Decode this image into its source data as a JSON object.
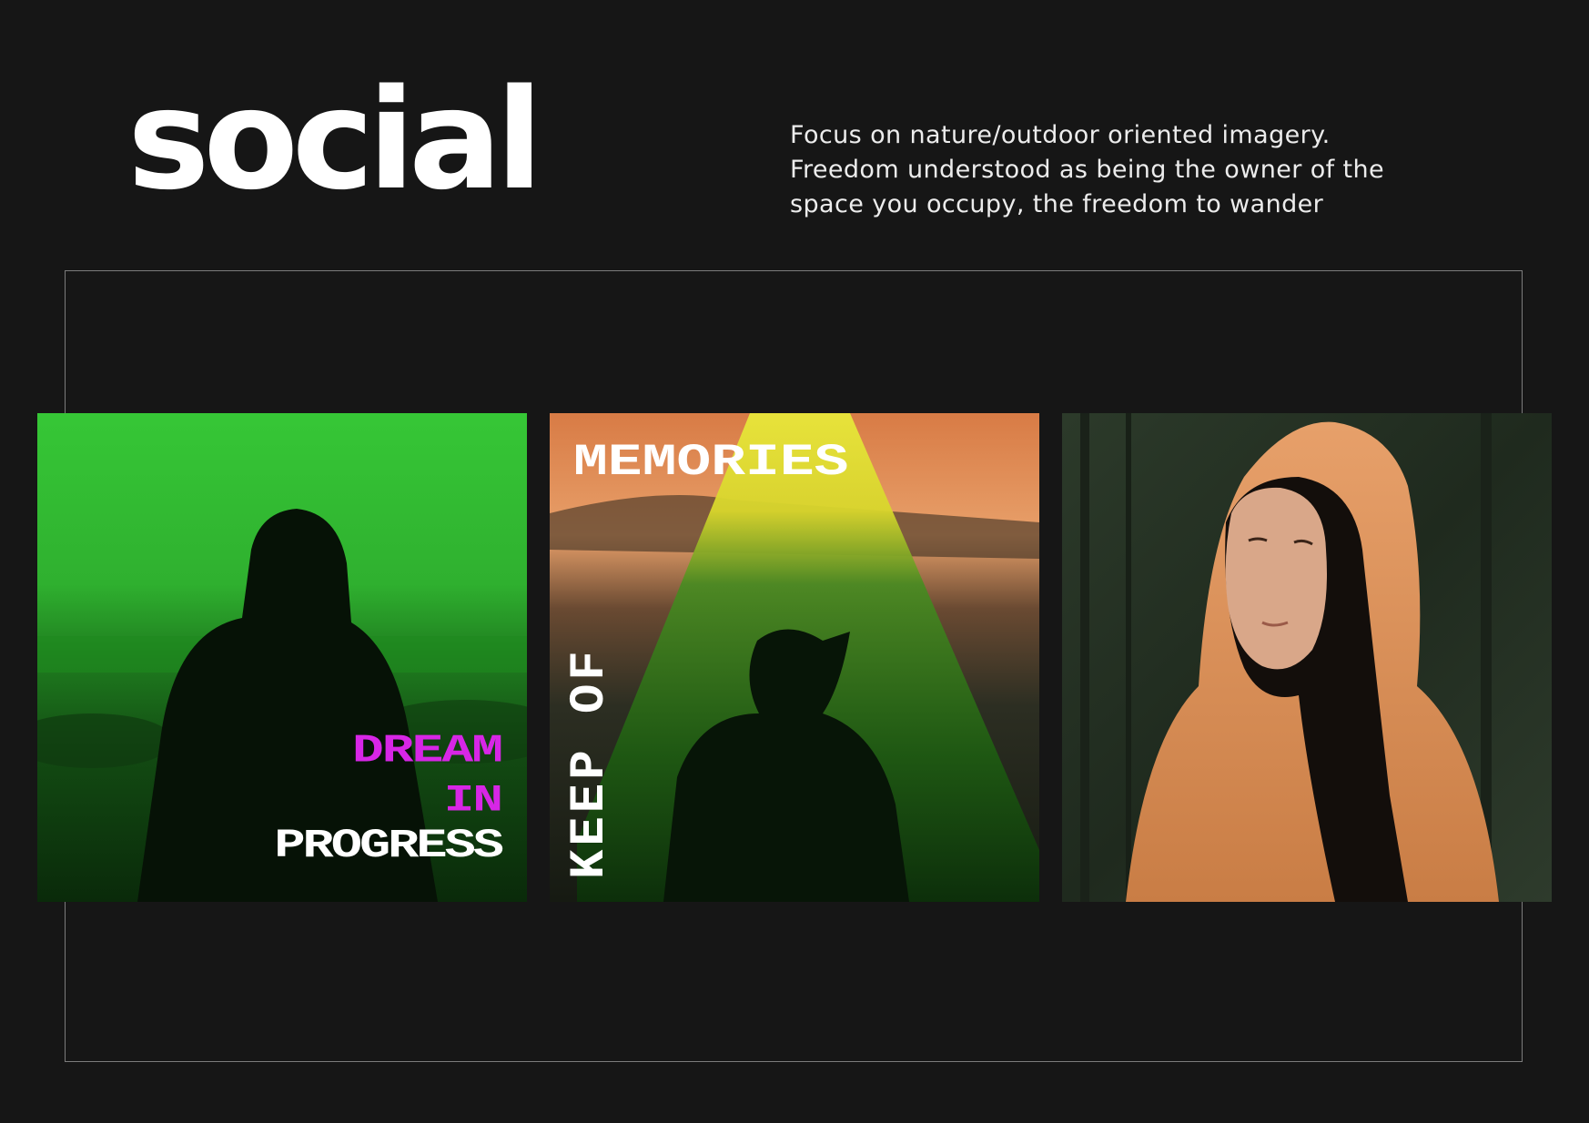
{
  "page": {
    "title": "social",
    "description_lines": [
      "Focus on nature/outdoor oriented imagery.",
      "Freedom understood as being the owner of the",
      "space you occupy, the freedom to wander"
    ]
  },
  "posts": [
    {
      "lines": [
        "DREAM",
        "IN",
        "PROGRESS"
      ],
      "accent": "#d726e6",
      "tint": "#2fb52f"
    },
    {
      "title": "MEMORIES",
      "vertical": "KEEP OF",
      "accent": "#e6e635",
      "tint": "#e8894b"
    },
    {
      "tint": "#e39a5e"
    }
  ]
}
